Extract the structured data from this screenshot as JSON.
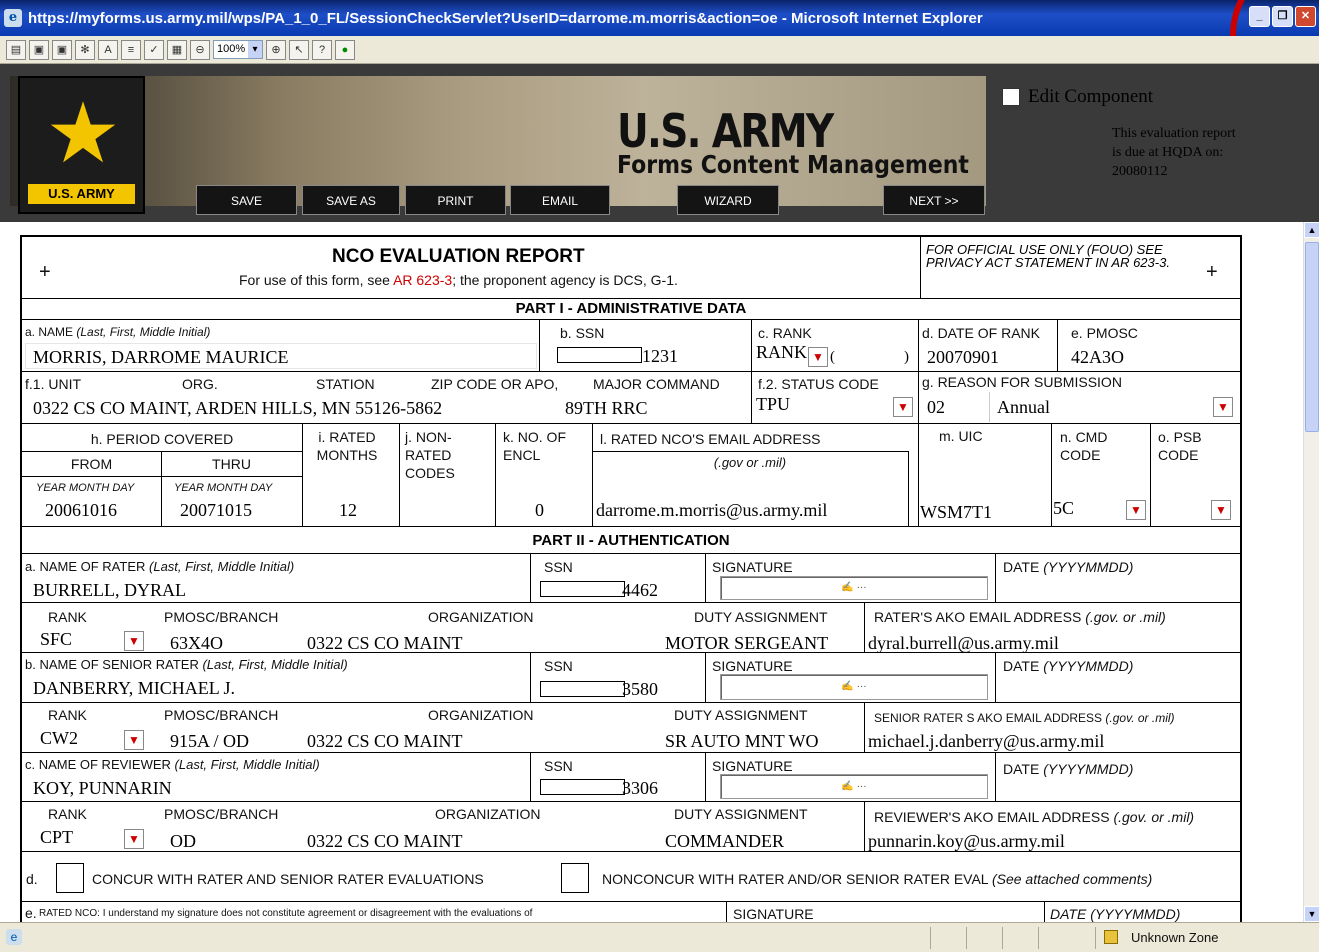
{
  "window": {
    "title": "https://myforms.us.army.mil/wps/PA_1_0_FL/SessionCheckServlet?UserID=darrome.m.morris&action=oe - Microsoft Internet Explorer",
    "min": "_",
    "max": "❐",
    "close": "✕"
  },
  "toolbar": {
    "zoom": "100%"
  },
  "banner": {
    "logo_text": "U.S. ARMY",
    "title": "U.S. ARMY",
    "subtitle": "Forms Content Management",
    "buttons": {
      "save": "SAVE",
      "save_as": "SAVE AS",
      "print": "PRINT",
      "email": "EMAIL",
      "wizard": "WIZARD",
      "next": "NEXT >>"
    },
    "edit_component": "Edit Component",
    "due_note": "This evaluation report is due at HQDA on: 20080112"
  },
  "form": {
    "plus": "+",
    "title": "NCO EVALUATION REPORT",
    "subtitle_pre": "For use of this form, see ",
    "subtitle_link": "AR 623-3",
    "subtitle_post": "; the proponent agency is DCS, G-1.",
    "fouo": "FOR OFFICIAL USE ONLY (FOUO) SEE PRIVACY ACT STATEMENT IN AR 623-3.",
    "part1": "PART I - ADMINISTRATIVE DATA",
    "name_label": "a. NAME",
    "name_hint": "(Last, First, Middle Initial)",
    "name": "MORRIS, DARROME MAURICE",
    "ssn_label": "b. SSN",
    "ssn_tail": "1231",
    "rank_label": "c. RANK",
    "rank": "RANK",
    "rank_paren_open": "(",
    "rank_paren_close": ")",
    "dor_label": "d. DATE OF RANK",
    "dor": "20070901",
    "pmosc_label": "e. PMOSC",
    "pmosc": "42A3O",
    "unit_label": "f.1. UNIT",
    "org_label": "ORG.",
    "station_label": "STATION",
    "zip_label": "ZIP CODE OR APO,",
    "major_label": "MAJOR COMMAND",
    "unit_value": "0322 CS CO MAINT, ARDEN HILLS, MN  55126-5862",
    "major_value": "89TH RRC",
    "status_label": "f.2. STATUS CODE",
    "status": "TPU",
    "reason_label": "g. REASON FOR SUBMISSION",
    "reason_code": "02",
    "reason": "Annual",
    "period_label": "h. PERIOD COVERED",
    "from": "FROM",
    "thru": "THRU",
    "ymd": "YEAR  MONTH DAY",
    "from_val": "20061016",
    "thru_val": "20071015",
    "rated_months_label": "i. RATED MONTHS",
    "rated_months": "12",
    "nonrated_label": "j. NON-RATED CODES",
    "encl_label": "k. NO. OF ENCL",
    "encl": "0",
    "email_label": "l. RATED NCO'S EMAIL ADDRESS",
    "email_hint": "(.gov or .mil)",
    "email": "darrome.m.morris@us.army.mil",
    "uic_label": "m. UIC",
    "uic": "WSM7T1",
    "cmd_label": "n. CMD CODE",
    "cmd": "5C",
    "psb_label": "o. PSB CODE",
    "part2": "PART II - AUTHENTICATION",
    "rater_label": "a. NAME OF RATER",
    "senior_label": "b. NAME OF SENIOR RATER",
    "reviewer_label": "c. NAME OF REVIEWER",
    "lfm": "(Last, First, Middle Initial)",
    "ssn": "SSN",
    "signature": "SIGNATURE",
    "date": "DATE",
    "date_hint": "(YYYYMMDD)",
    "pmosc_branch": "PMOSC/BRANCH",
    "organization": "ORGANIZATION",
    "duty": "DUTY ASSIGNMENT",
    "rater_email_label": "RATER'S AKO EMAIL ADDRESS",
    "senior_email_label": "SENIOR RATER S AKO EMAIL ADDRESS",
    "reviewer_email_label": "REVIEWER'S AKO EMAIL ADDRESS",
    "gov_mil": "(.gov. or .mil)",
    "rater": {
      "name": "BURRELL, DYRAL",
      "ssn_tail": "4462",
      "rank": "SFC",
      "pmosc": "63X4O",
      "org": "0322 CS CO MAINT",
      "duty": "MOTOR SERGEANT",
      "email": "dyral.burrell@us.army.mil"
    },
    "senior": {
      "name": "DANBERRY, MICHAEL J.",
      "ssn_tail": "3580",
      "rank": "CW2",
      "pmosc": "915A / OD",
      "org": "0322 CS CO MAINT",
      "duty": "SR AUTO MNT WO",
      "email": "michael.j.danberry@us.army.mil"
    },
    "reviewer": {
      "name": "KOY, PUNNARIN",
      "ssn_tail": "3306",
      "rank": "CPT",
      "pmosc": "OD",
      "org": "0322 CS CO MAINT",
      "duty": "COMMANDER",
      "email": "punnarin.koy@us.army.mil"
    },
    "d_label": "d.",
    "concur": "CONCUR WITH RATER AND SENIOR RATER EVALUATIONS",
    "nonconcur": "NONCONCUR WITH RATER AND/OR SENIOR RATER EVAL",
    "nonconcur_hint": "(See attached comments)",
    "e_label": "e.",
    "e_text": "RATED NCO:  I understand my signature does not constitute agreement or disagreement with the evaluations of",
    "date_ymd": "DATE (YYYYMMDD)"
  },
  "status_bar": {
    "zone": "Unknown Zone"
  }
}
